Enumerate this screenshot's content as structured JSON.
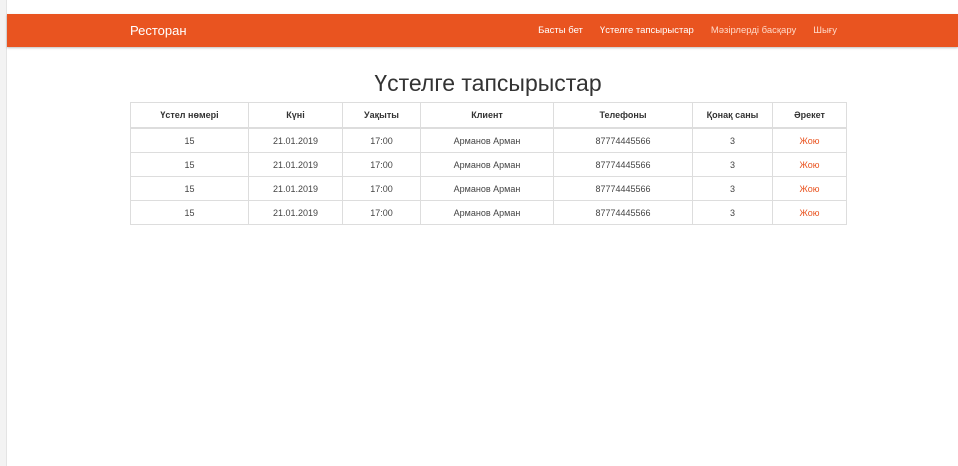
{
  "navbar": {
    "brand": "Ресторан",
    "links": [
      "Басты бет",
      "Үстелге тапсырыстар",
      "Мәзірлерді басқару",
      "Шығу"
    ]
  },
  "page": {
    "title": "Үстелге тапсырыстар"
  },
  "table": {
    "headers": [
      "Үстел нөмері",
      "Күні",
      "Уақыты",
      "Клиент",
      "Телефоны",
      "Қонақ саны",
      "Әрекет"
    ],
    "rows": [
      [
        "15",
        "21.01.2019",
        "17:00",
        "Арманов Арман",
        "87774445566",
        "3",
        "Жою"
      ],
      [
        "15",
        "21.01.2019",
        "17:00",
        "Арманов Арман",
        "87774445566",
        "3",
        "Жою"
      ],
      [
        "15",
        "21.01.2019",
        "17:00",
        "Арманов Арман",
        "87774445566",
        "3",
        "Жою"
      ],
      [
        "15",
        "21.01.2019",
        "17:00",
        "Арманов Арман",
        "87774445566",
        "3",
        "Жою"
      ]
    ]
  },
  "colors": {
    "accent": "#e95420",
    "link_muted": "#ffd9c8"
  }
}
